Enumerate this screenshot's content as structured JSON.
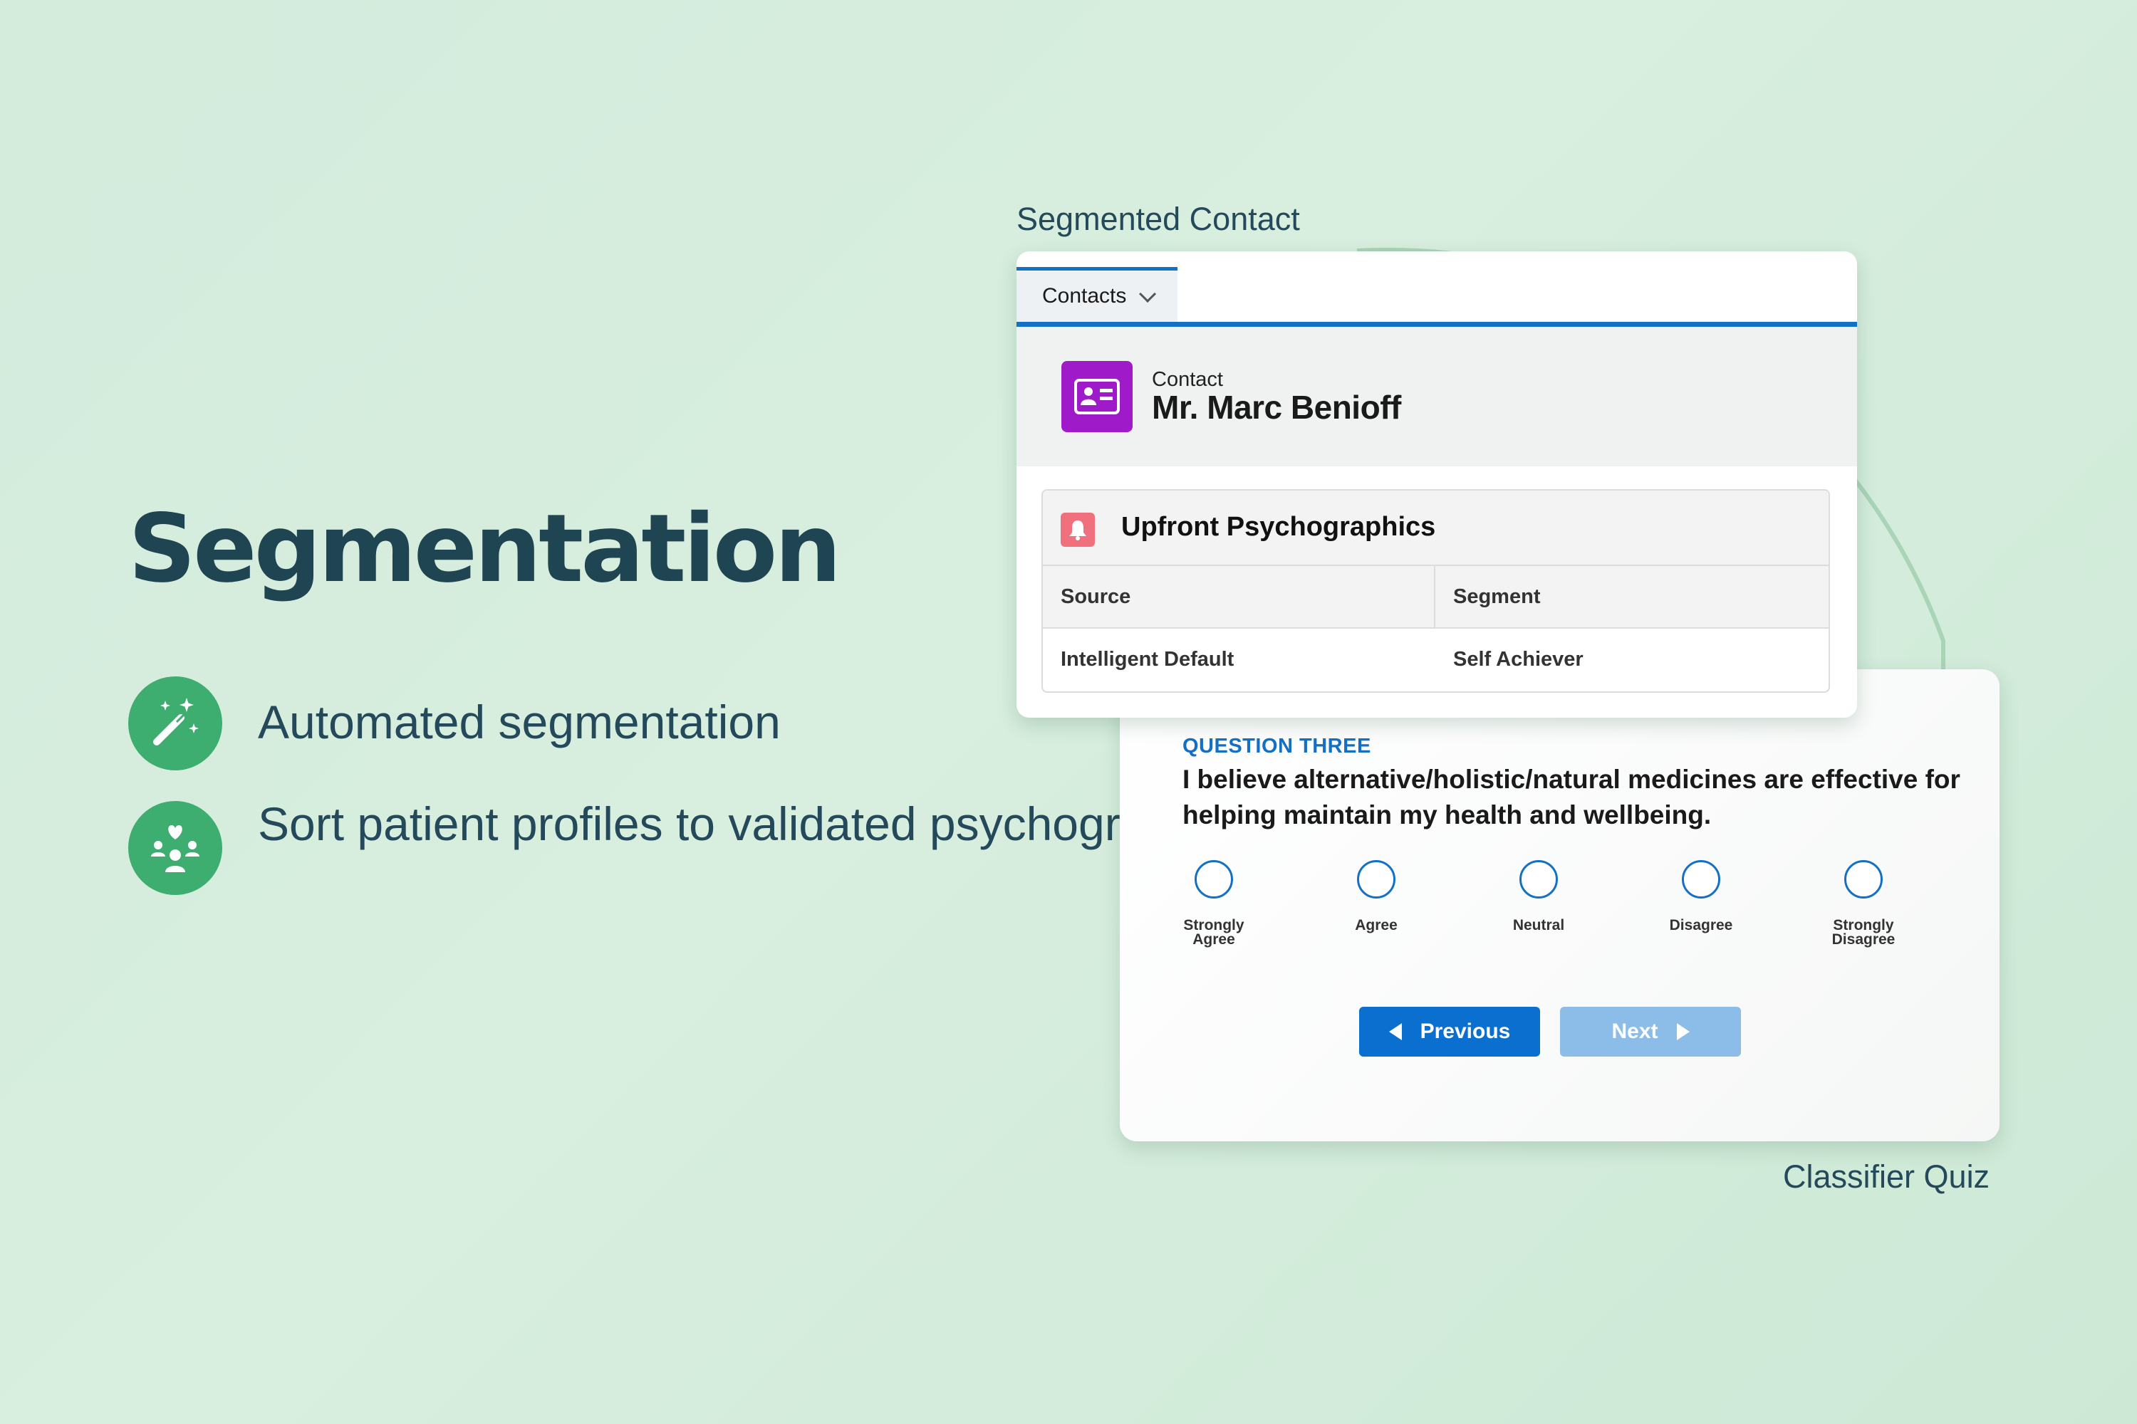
{
  "hero": {
    "title": "Segmentation",
    "features": [
      {
        "icon": "magic-wand-icon",
        "text": "Automated segmentation"
      },
      {
        "icon": "persona-group-icon",
        "text": "Sort patient profiles to validated psychographic personas"
      }
    ]
  },
  "captions": {
    "contact": "Segmented Contact",
    "quiz": "Classifier Quiz"
  },
  "contact_card": {
    "tab_label": "Contacts",
    "record_type": "Contact",
    "record_name": "Mr. Marc Benioff",
    "related_list": {
      "title": "Upfront Psychographics",
      "columns": [
        "Source",
        "Segment"
      ],
      "rows": [
        [
          "Intelligent Default",
          "Self Achiever"
        ]
      ]
    }
  },
  "quiz_card": {
    "question_label": "QUESTION THREE",
    "question_text": "I believe alternative/holistic/natural medicines are effective for helping maintain my health and wellbeing.",
    "options": [
      {
        "line1": "Strongly",
        "line2": "Agree"
      },
      {
        "line1": "Agree",
        "line2": ""
      },
      {
        "line1": "Neutral",
        "line2": ""
      },
      {
        "line1": "Disagree",
        "line2": ""
      },
      {
        "line1": "Strongly",
        "line2": "Disagree"
      }
    ],
    "previous_label": "Previous",
    "next_label": "Next"
  },
  "colors": {
    "background": "#d3ecdc",
    "accent_green": "#3dae6f",
    "brand_blue": "#1470c4",
    "contact_icon": "#9f1ac9",
    "title_text": "#1f4452"
  }
}
